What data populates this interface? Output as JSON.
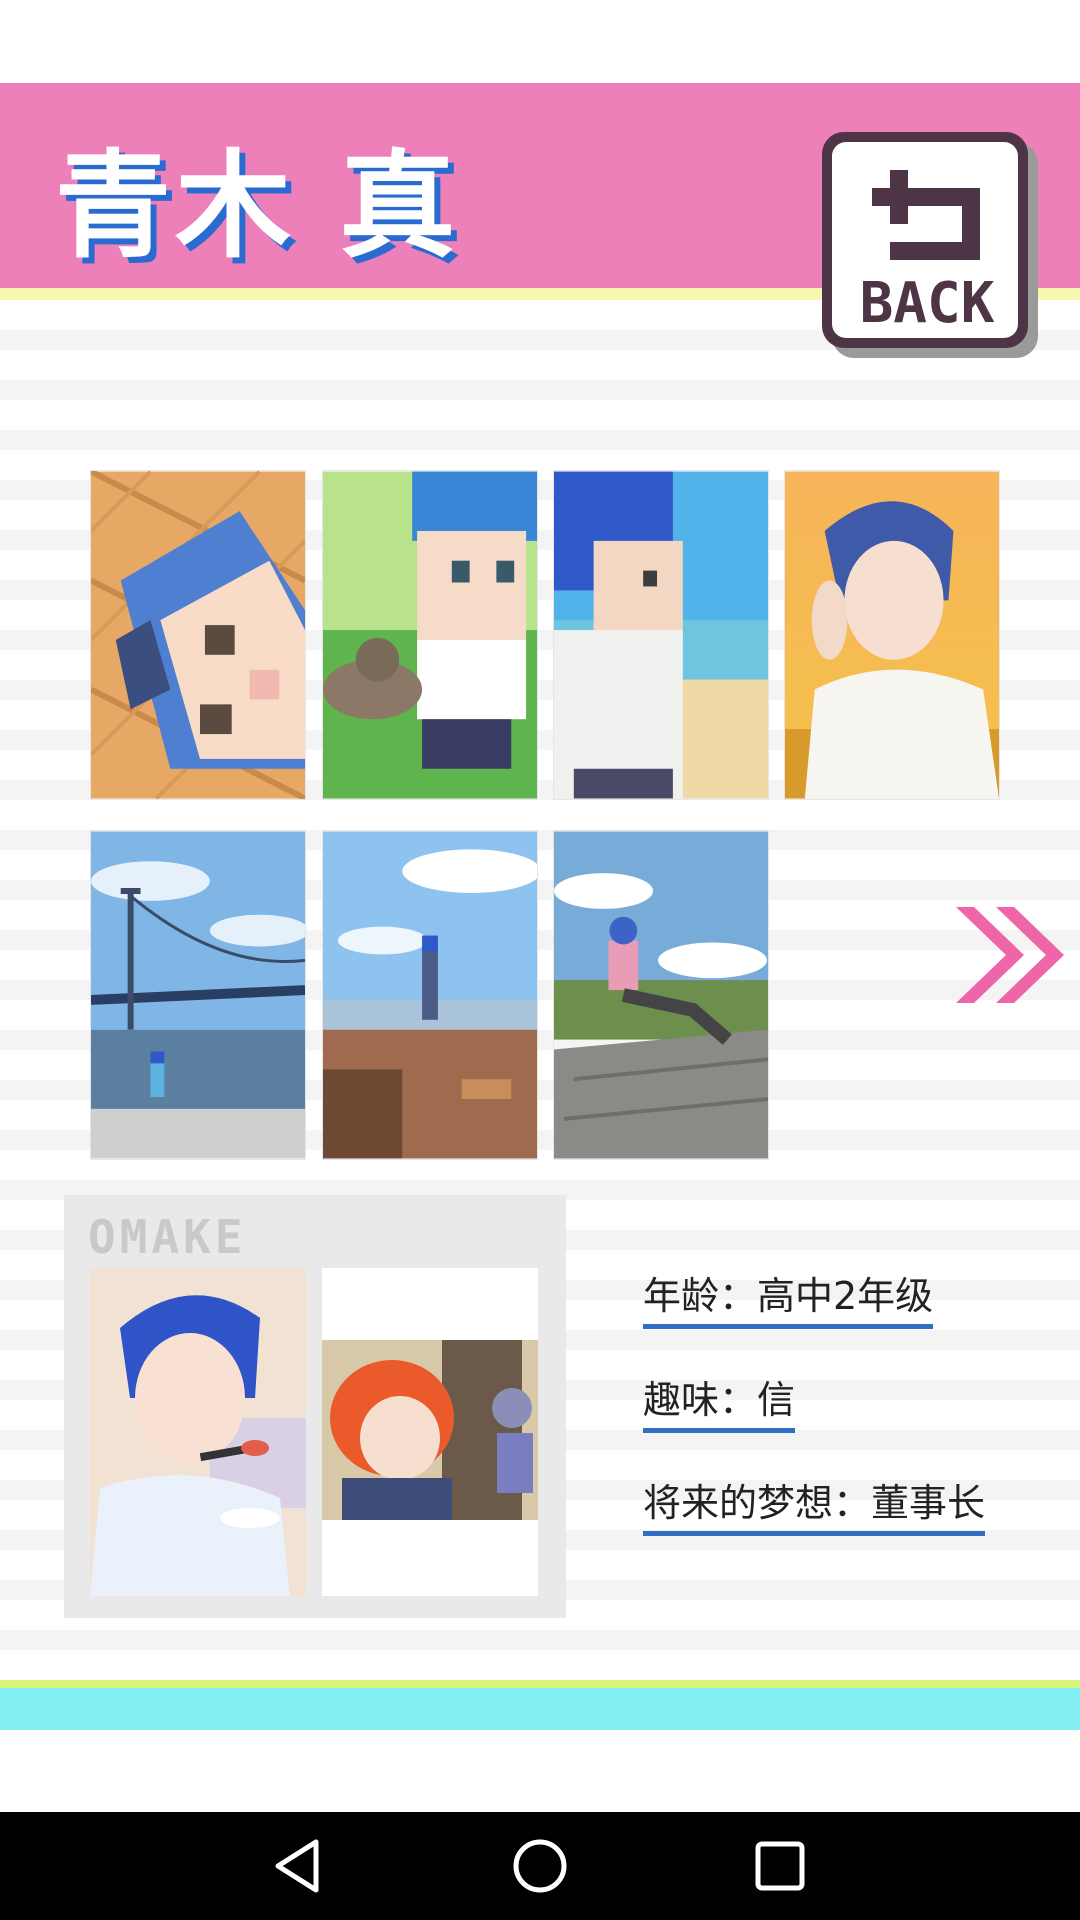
{
  "header": {
    "title": "青木 真",
    "back_label": "BACK",
    "back_icon": "return-arrow-icon",
    "colors": {
      "banner": "#ee80b9",
      "title_shadow": "#2b6bd1",
      "accent_line": "#f8f7b0"
    }
  },
  "gallery": {
    "thumbnails": [
      {
        "name": "pixel-face-floor"
      },
      {
        "name": "pixel-boy-with-cat"
      },
      {
        "name": "pixel-boy-beach"
      },
      {
        "name": "anime-boy-sunset"
      },
      {
        "name": "bridge-photo"
      },
      {
        "name": "lookout-photo"
      },
      {
        "name": "boy-sitting-bench"
      }
    ],
    "next_icon": "double-chevron-right-icon"
  },
  "omake": {
    "label": "OMAKE",
    "items": [
      {
        "name": "boy-eating-sushi"
      },
      {
        "name": "red-haired-kid-scene"
      }
    ]
  },
  "profile": {
    "age": "年龄：高中2年级",
    "hobby": "趣味：信",
    "dream": "将来的梦想：董事长"
  },
  "navbar": {
    "back_icon": "triangle-back-icon",
    "home_icon": "circle-home-icon",
    "recents_icon": "square-recents-icon"
  }
}
